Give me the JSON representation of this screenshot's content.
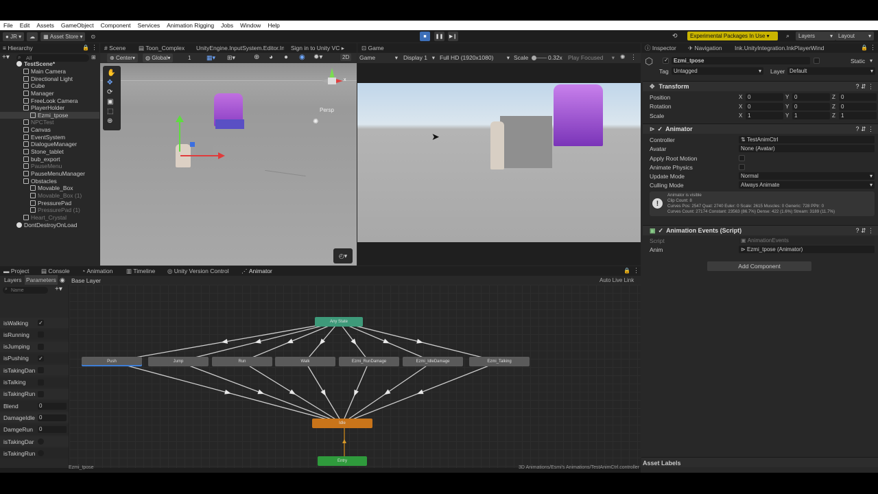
{
  "menu": [
    "File",
    "Edit",
    "Assets",
    "GameObject",
    "Component",
    "Services",
    "Animation Rigging",
    "Jobs",
    "Window",
    "Help"
  ],
  "toolbar": {
    "account": "JR",
    "asset_store": "Asset Store",
    "experimental": "Experimental Packages In Use",
    "layers": "Layers",
    "layout": "Layout"
  },
  "hierarchy": {
    "tab": "Hierarchy",
    "search_placeholder": "All",
    "items": [
      {
        "label": "TestScene*",
        "indent": 0,
        "type": "scene",
        "dim": false
      },
      {
        "label": "Main Camera",
        "indent": 1,
        "type": "obj",
        "dim": false
      },
      {
        "label": "Directional Light",
        "indent": 1,
        "type": "obj",
        "dim": false
      },
      {
        "label": "Cube",
        "indent": 1,
        "type": "obj",
        "dim": false
      },
      {
        "label": "Manager",
        "indent": 1,
        "type": "obj",
        "dim": false
      },
      {
        "label": "FreeLook Camera",
        "indent": 1,
        "type": "obj",
        "dim": false
      },
      {
        "label": "PlayerHolder",
        "indent": 1,
        "type": "obj",
        "dim": false
      },
      {
        "label": "Ezmi_tpose",
        "indent": 2,
        "type": "obj",
        "dim": false,
        "selected": true
      },
      {
        "label": "NPCTest",
        "indent": 1,
        "type": "obj",
        "dim": true
      },
      {
        "label": "Canvas",
        "indent": 1,
        "type": "obj",
        "dim": false
      },
      {
        "label": "EventSystem",
        "indent": 1,
        "type": "obj",
        "dim": false
      },
      {
        "label": "DialogueManager",
        "indent": 1,
        "type": "obj",
        "dim": false
      },
      {
        "label": "Stone_tablet",
        "indent": 1,
        "type": "obj",
        "dim": false
      },
      {
        "label": "bub_export",
        "indent": 1,
        "type": "obj",
        "dim": false
      },
      {
        "label": "PauseMenu",
        "indent": 1,
        "type": "obj",
        "dim": true
      },
      {
        "label": "PauseMenuManager",
        "indent": 1,
        "type": "obj",
        "dim": false
      },
      {
        "label": "Obstacles",
        "indent": 1,
        "type": "obj",
        "dim": false
      },
      {
        "label": "Movable_Box",
        "indent": 2,
        "type": "obj",
        "dim": false
      },
      {
        "label": "Movable_Box (1)",
        "indent": 2,
        "type": "obj",
        "dim": true
      },
      {
        "label": "PressurePad",
        "indent": 2,
        "type": "obj",
        "dim": false
      },
      {
        "label": "PressurePad (1)",
        "indent": 2,
        "type": "obj",
        "dim": true
      },
      {
        "label": "Heart_Crystal",
        "indent": 1,
        "type": "obj",
        "dim": true
      },
      {
        "label": "DontDestroyOnLoad",
        "indent": 0,
        "type": "scene",
        "dim": false
      }
    ]
  },
  "scene_tabs": [
    "Scene",
    "Toon_Complex",
    "UnityEngine.InputSystem.Editor.In",
    "Sign in to Unity VC"
  ],
  "scene_toolbar": {
    "pivot": "Center",
    "space": "Global",
    "snap": "1",
    "mode": "2D"
  },
  "scene_persp": "Persp",
  "game": {
    "tab": "Game",
    "view": "Game",
    "display": "Display 1",
    "resolution": "Full HD (1920x1080)",
    "scale_label": "Scale",
    "scale_value": "0.32x",
    "play_focused": "Play Focused"
  },
  "inspector": {
    "tabs": [
      "Inspector",
      "Navigation",
      "Ink.UnityIntegration.InkPlayerWind"
    ],
    "object_name": "Ezmi_tpose",
    "static_label": "Static",
    "tag_label": "Tag",
    "tag_value": "Untagged",
    "layer_label": "Layer",
    "layer_value": "Default",
    "transform": {
      "title": "Transform",
      "rows": [
        {
          "label": "Position",
          "x": "0",
          "y": "0",
          "z": "0"
        },
        {
          "label": "Rotation",
          "x": "0",
          "y": "0",
          "z": "0"
        },
        {
          "label": "Scale",
          "x": "1",
          "y": "1",
          "z": "1"
        }
      ]
    },
    "animator": {
      "title": "Animator",
      "controller_label": "Controller",
      "controller_value": "TestAnimCtrl",
      "avatar_label": "Avatar",
      "avatar_value": "None (Avatar)",
      "apply_root_motion": "Apply Root Motion",
      "animate_physics": "Animate Physics",
      "update_mode_label": "Update Mode",
      "update_mode_value": "Normal",
      "culling_mode_label": "Culling Mode",
      "culling_mode_value": "Always Animate",
      "info": [
        "Animator is visible",
        "Clip Count: 8",
        "Curves Pos: 2547 Quat: 2740 Euler: 0 Scale: 2615 Muscles: 0 Generic: 728 PPtr: 0",
        "Curves Count: 27174 Constant: 23563 (86.7%) Dense: 422 (1.6%) Stream: 3189 (11.7%)"
      ]
    },
    "anim_events": {
      "title": "Animation Events (Script)",
      "script_label": "Script",
      "script_value": "AnimationEvents",
      "anim_label": "Anim",
      "anim_value": "Ezmi_tpose (Animator)"
    },
    "add_component": "Add Component",
    "asset_labels": "Asset Labels"
  },
  "bottom_tabs": [
    "Project",
    "Console",
    "Animation",
    "Timeline",
    "Unity Version Control",
    "Animator"
  ],
  "animator_window": {
    "sub_tabs": [
      "Layers",
      "Parameters"
    ],
    "breadcrumb": "Base Layer",
    "auto_live_link": "Auto Live Link",
    "search_placeholder": "Name",
    "parameters": [
      {
        "name": "isWalking",
        "type": "bool",
        "checked": true
      },
      {
        "name": "isRunning",
        "type": "bool",
        "checked": false
      },
      {
        "name": "isJumping",
        "type": "bool",
        "checked": false
      },
      {
        "name": "isPushing",
        "type": "bool",
        "checked": true
      },
      {
        "name": "isTakingDan",
        "type": "bool",
        "checked": false
      },
      {
        "name": "isTalking",
        "type": "bool",
        "checked": false
      },
      {
        "name": "isTakingRun",
        "type": "bool",
        "checked": false
      },
      {
        "name": "Blend",
        "type": "float",
        "value": "0"
      },
      {
        "name": "DamageIdle",
        "type": "float",
        "value": "0"
      },
      {
        "name": "DamgeRun",
        "type": "float",
        "value": "0"
      },
      {
        "name": "isTakingDar",
        "type": "trigger"
      },
      {
        "name": "isTakingRun",
        "type": "trigger"
      }
    ],
    "states": {
      "any": "Any State",
      "row": [
        "Push",
        "Jump",
        "Run",
        "Walk",
        "Ezmi_RunDamage",
        "Ezmi_IdleDamage",
        "Ezmi_Talking"
      ],
      "idle": "Idle",
      "entry": "Entry"
    },
    "colors": {
      "any": "#3e9a7a",
      "idle": "#c8741a",
      "entry": "#2f9a3c",
      "state": "#5a5a5a"
    }
  },
  "status": {
    "left": "Ezmi_tpose",
    "right": "3D Animations/Esmi's Animations/TestAnimCtrl.controller"
  }
}
